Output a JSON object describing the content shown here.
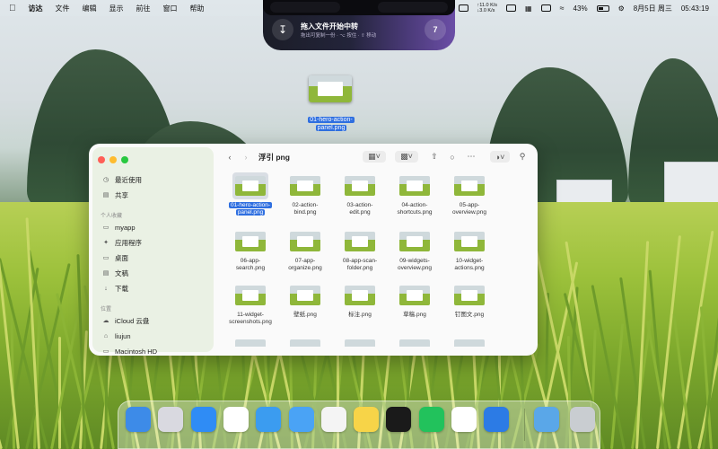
{
  "menubar": {
    "app_name": "访达",
    "menus": [
      "文件",
      "编辑",
      "显示",
      "前往",
      "窗口",
      "帮助"
    ],
    "net_up": "↑11.0 K/s",
    "net_down": "↓3.0 K/s",
    "battery": "43%",
    "date": "8月5日 周三",
    "time": "05:43:19"
  },
  "island": {
    "title": "拖入文件开始中转",
    "subtitle": "拖出可复制一份 · ⌥ 按住 · ⇧ 移动",
    "count": "7"
  },
  "dragged": {
    "label_line1": "01-hero-action-",
    "label_line2": "panel.png"
  },
  "finder": {
    "title": "浮引 png",
    "sidebar": {
      "favorites": [
        {
          "label": "最近使用",
          "icon": "clock-icon"
        },
        {
          "label": "共享",
          "icon": "shared-folder-icon"
        }
      ],
      "section_personal": "个人收藏",
      "personal": [
        {
          "label": "myapp",
          "icon": "folder-icon"
        },
        {
          "label": "应用程序",
          "icon": "applications-icon"
        },
        {
          "label": "桌面",
          "icon": "desktop-icon"
        },
        {
          "label": "文稿",
          "icon": "documents-icon"
        },
        {
          "label": "下载",
          "icon": "downloads-icon"
        }
      ],
      "section_locations": "位置",
      "locations": [
        {
          "label": "iCloud 云盘",
          "icon": "icloud-icon"
        },
        {
          "label": "liujun",
          "icon": "home-icon"
        },
        {
          "label": "Macintosh HD",
          "icon": "disk-icon"
        }
      ]
    },
    "files": [
      {
        "l1": "01-hero-action-",
        "l2": "panel.png",
        "selected": true
      },
      {
        "l1": "02-action-",
        "l2": "bind.png"
      },
      {
        "l1": "03-action-",
        "l2": "edit.png"
      },
      {
        "l1": "04-action-",
        "l2": "shortcuts.png"
      },
      {
        "l1": "05-app-",
        "l2": "overview.png"
      },
      {
        "l1": "06-app-",
        "l2": "search.png"
      },
      {
        "l1": "07-app-",
        "l2": "organize.png"
      },
      {
        "l1": "08-app-scan-",
        "l2": "folder.png"
      },
      {
        "l1": "09-widgets-",
        "l2": "overview.png"
      },
      {
        "l1": "10-widget-",
        "l2": "actions.png"
      },
      {
        "l1": "11-widget-",
        "l2": "screenshots.png"
      },
      {
        "l1": "壁纸.png",
        "l2": ""
      },
      {
        "l1": "标注.png",
        "l2": ""
      },
      {
        "l1": "草稿.png",
        "l2": ""
      },
      {
        "l1": "钉图文.png",
        "l2": ""
      }
    ]
  },
  "dock": {
    "apps": [
      "finder-icon",
      "launchpad-icon",
      "app-store-icon",
      "chrome-icon",
      "safari-icon",
      "mail-icon",
      "reminders-icon",
      "notes-icon",
      "qq-icon",
      "wechat-icon",
      "chatgpt-icon",
      "xcode-icon",
      "downloads-folder-icon",
      "trash-icon"
    ],
    "colors": [
      "#3d8be8",
      "#d9d9e0",
      "#2f8cf5",
      "#ffffff",
      "#3b9cf0",
      "#4aa3f5",
      "#f4f4f4",
      "#f7d448",
      "#1a1a1a",
      "#22c25c",
      "#ffffff",
      "#2c7be5",
      "#5aa7e8",
      "#c9cdd1"
    ]
  }
}
